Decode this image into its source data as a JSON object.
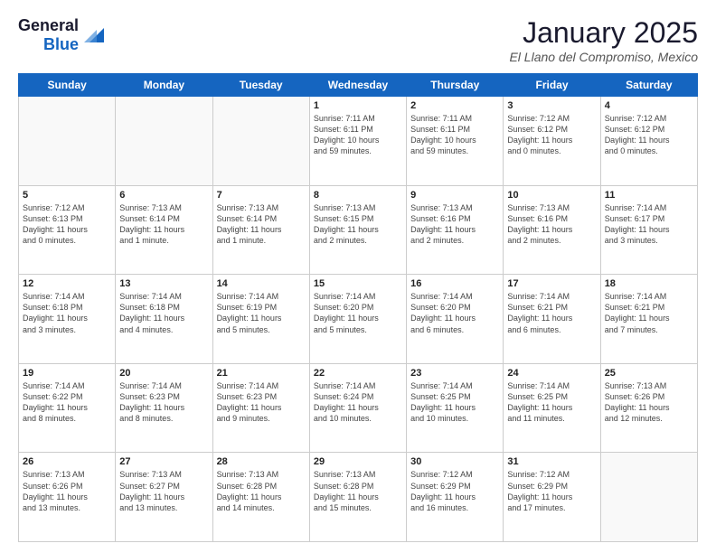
{
  "header": {
    "logo_line1": "General",
    "logo_line2": "Blue",
    "month_title": "January 2025",
    "subtitle": "El Llano del Compromiso, Mexico"
  },
  "days_of_week": [
    "Sunday",
    "Monday",
    "Tuesday",
    "Wednesday",
    "Thursday",
    "Friday",
    "Saturday"
  ],
  "weeks": [
    [
      {
        "num": "",
        "info": ""
      },
      {
        "num": "",
        "info": ""
      },
      {
        "num": "",
        "info": ""
      },
      {
        "num": "1",
        "info": "Sunrise: 7:11 AM\nSunset: 6:11 PM\nDaylight: 10 hours\nand 59 minutes."
      },
      {
        "num": "2",
        "info": "Sunrise: 7:11 AM\nSunset: 6:11 PM\nDaylight: 10 hours\nand 59 minutes."
      },
      {
        "num": "3",
        "info": "Sunrise: 7:12 AM\nSunset: 6:12 PM\nDaylight: 11 hours\nand 0 minutes."
      },
      {
        "num": "4",
        "info": "Sunrise: 7:12 AM\nSunset: 6:12 PM\nDaylight: 11 hours\nand 0 minutes."
      }
    ],
    [
      {
        "num": "5",
        "info": "Sunrise: 7:12 AM\nSunset: 6:13 PM\nDaylight: 11 hours\nand 0 minutes."
      },
      {
        "num": "6",
        "info": "Sunrise: 7:13 AM\nSunset: 6:14 PM\nDaylight: 11 hours\nand 1 minute."
      },
      {
        "num": "7",
        "info": "Sunrise: 7:13 AM\nSunset: 6:14 PM\nDaylight: 11 hours\nand 1 minute."
      },
      {
        "num": "8",
        "info": "Sunrise: 7:13 AM\nSunset: 6:15 PM\nDaylight: 11 hours\nand 2 minutes."
      },
      {
        "num": "9",
        "info": "Sunrise: 7:13 AM\nSunset: 6:16 PM\nDaylight: 11 hours\nand 2 minutes."
      },
      {
        "num": "10",
        "info": "Sunrise: 7:13 AM\nSunset: 6:16 PM\nDaylight: 11 hours\nand 2 minutes."
      },
      {
        "num": "11",
        "info": "Sunrise: 7:14 AM\nSunset: 6:17 PM\nDaylight: 11 hours\nand 3 minutes."
      }
    ],
    [
      {
        "num": "12",
        "info": "Sunrise: 7:14 AM\nSunset: 6:18 PM\nDaylight: 11 hours\nand 3 minutes."
      },
      {
        "num": "13",
        "info": "Sunrise: 7:14 AM\nSunset: 6:18 PM\nDaylight: 11 hours\nand 4 minutes."
      },
      {
        "num": "14",
        "info": "Sunrise: 7:14 AM\nSunset: 6:19 PM\nDaylight: 11 hours\nand 5 minutes."
      },
      {
        "num": "15",
        "info": "Sunrise: 7:14 AM\nSunset: 6:20 PM\nDaylight: 11 hours\nand 5 minutes."
      },
      {
        "num": "16",
        "info": "Sunrise: 7:14 AM\nSunset: 6:20 PM\nDaylight: 11 hours\nand 6 minutes."
      },
      {
        "num": "17",
        "info": "Sunrise: 7:14 AM\nSunset: 6:21 PM\nDaylight: 11 hours\nand 6 minutes."
      },
      {
        "num": "18",
        "info": "Sunrise: 7:14 AM\nSunset: 6:21 PM\nDaylight: 11 hours\nand 7 minutes."
      }
    ],
    [
      {
        "num": "19",
        "info": "Sunrise: 7:14 AM\nSunset: 6:22 PM\nDaylight: 11 hours\nand 8 minutes."
      },
      {
        "num": "20",
        "info": "Sunrise: 7:14 AM\nSunset: 6:23 PM\nDaylight: 11 hours\nand 8 minutes."
      },
      {
        "num": "21",
        "info": "Sunrise: 7:14 AM\nSunset: 6:23 PM\nDaylight: 11 hours\nand 9 minutes."
      },
      {
        "num": "22",
        "info": "Sunrise: 7:14 AM\nSunset: 6:24 PM\nDaylight: 11 hours\nand 10 minutes."
      },
      {
        "num": "23",
        "info": "Sunrise: 7:14 AM\nSunset: 6:25 PM\nDaylight: 11 hours\nand 10 minutes."
      },
      {
        "num": "24",
        "info": "Sunrise: 7:14 AM\nSunset: 6:25 PM\nDaylight: 11 hours\nand 11 minutes."
      },
      {
        "num": "25",
        "info": "Sunrise: 7:13 AM\nSunset: 6:26 PM\nDaylight: 11 hours\nand 12 minutes."
      }
    ],
    [
      {
        "num": "26",
        "info": "Sunrise: 7:13 AM\nSunset: 6:26 PM\nDaylight: 11 hours\nand 13 minutes."
      },
      {
        "num": "27",
        "info": "Sunrise: 7:13 AM\nSunset: 6:27 PM\nDaylight: 11 hours\nand 13 minutes."
      },
      {
        "num": "28",
        "info": "Sunrise: 7:13 AM\nSunset: 6:28 PM\nDaylight: 11 hours\nand 14 minutes."
      },
      {
        "num": "29",
        "info": "Sunrise: 7:13 AM\nSunset: 6:28 PM\nDaylight: 11 hours\nand 15 minutes."
      },
      {
        "num": "30",
        "info": "Sunrise: 7:12 AM\nSunset: 6:29 PM\nDaylight: 11 hours\nand 16 minutes."
      },
      {
        "num": "31",
        "info": "Sunrise: 7:12 AM\nSunset: 6:29 PM\nDaylight: 11 hours\nand 17 minutes."
      },
      {
        "num": "",
        "info": ""
      }
    ]
  ]
}
